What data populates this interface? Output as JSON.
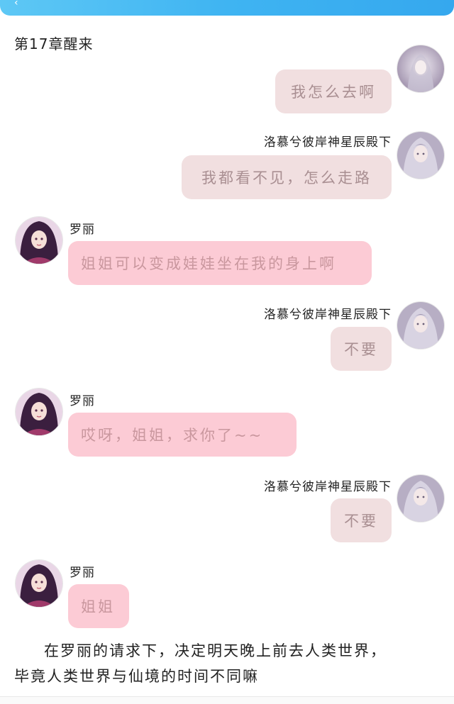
{
  "chapter_title": "第17章醒来",
  "messages": [
    {
      "side": "right",
      "name": "",
      "text": "我怎么去啊"
    },
    {
      "side": "right",
      "name": "洛慕兮彼岸神星辰殿下",
      "text": "我都看不见，怎么走路"
    },
    {
      "side": "left",
      "name": "罗丽",
      "text": "姐姐可以变成娃娃坐在我的身上啊"
    },
    {
      "side": "right",
      "name": "洛慕兮彼岸神星辰殿下",
      "text": "不要"
    },
    {
      "side": "left",
      "name": "罗丽",
      "text": "哎呀，姐姐，求你了~~"
    },
    {
      "side": "right",
      "name": "洛慕兮彼岸神星辰殿下",
      "text": "不要"
    },
    {
      "side": "left",
      "name": "罗丽",
      "text": "姐姐"
    }
  ],
  "narration": {
    "line1": "在罗丽的请求下，决定明天晚上前去人类世界，",
    "line2": "毕竟人类世界与仙境的时间不同嘛"
  },
  "colors": {
    "topbar": "#3fb4f2",
    "my_bubble": "#f1dfe0",
    "her_bubble": "#fccbd5"
  },
  "icons": {
    "back": "chevron-left-icon",
    "right_avatar": "avatar-silver-hair-girl",
    "left_avatar": "avatar-doll-girl"
  }
}
